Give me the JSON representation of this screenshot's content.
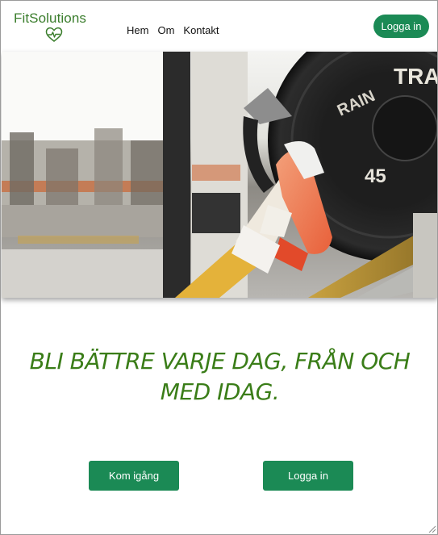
{
  "header": {
    "logo_text": "FitSolutions",
    "nav": {
      "home": "Hem",
      "about": "Om",
      "contact": "Kontakt"
    },
    "login_label": "Logga in"
  },
  "hero": {
    "plate_text_top": "TRA",
    "plate_text_side": "RAIN",
    "plate_weight": "45"
  },
  "main": {
    "headline": "BLI BÄTTRE VARJE DAG, FRÅN OCH MED IDAG.",
    "cta_start_label": "Kom igång",
    "cta_login_label": "Logga in"
  },
  "colors": {
    "brand_green": "#1b8a55",
    "logo_green": "#3a7d2c",
    "headline_green": "#3a7d18"
  }
}
